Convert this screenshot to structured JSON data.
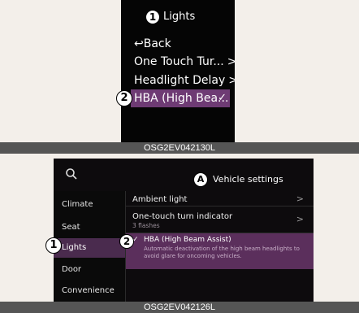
{
  "cluster": {
    "callout_1": "1",
    "title": "Lights",
    "back_label": "Back",
    "back_icon": "return-arrow-icon",
    "items": [
      {
        "label": "One Touch Tur...",
        "chevron": ">"
      },
      {
        "label": "Headlight Delay",
        "chevron": ">"
      }
    ],
    "hba": {
      "callout": "2",
      "label": "HBA (High Bea...",
      "checked": true
    }
  },
  "caption_top": "OSG2EV042130L",
  "settings": {
    "callout_a": "A",
    "title": "Vehicle settings",
    "sidebar": [
      "Climate",
      "Seat",
      "Lights",
      "Door",
      "Convenience"
    ],
    "active_item": "Lights",
    "callout_1": "1",
    "rows": {
      "ambient": {
        "label": "Ambient light",
        "chevron": ">"
      },
      "one_touch": {
        "label": "One-touch turn indicator",
        "sub": "3 flashes",
        "chevron": ">"
      },
      "hba": {
        "callout": "2",
        "label": "HBA (High Beam Assist)",
        "desc": "Automatic deactivation of the high beam headlights to avoid glare for oncoming vehicles.",
        "checked": true
      }
    }
  },
  "caption_bottom": "OSG2EV042126L",
  "colors": {
    "highlight": "#6e3b74",
    "caption": "#555555",
    "background": "#f3efea"
  }
}
